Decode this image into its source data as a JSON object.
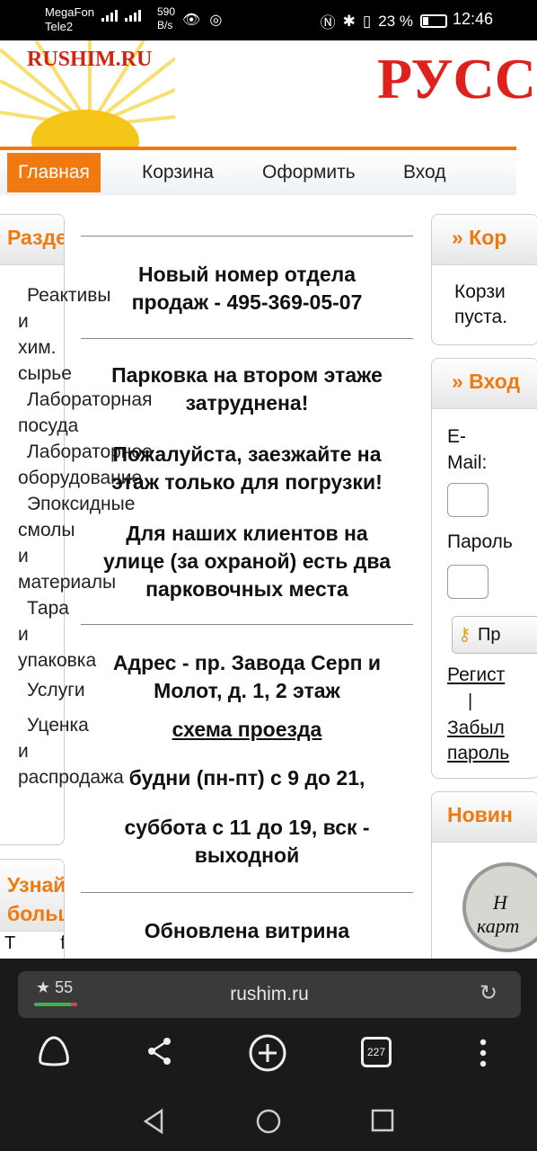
{
  "status": {
    "operator1": "MegaFon",
    "operator2": "Tele2",
    "speed": "590",
    "speed_unit": "B/s",
    "battery": "23 %",
    "time": "12:46"
  },
  "header": {
    "logo": "RUSHIM.RU",
    "banner": "РУССК"
  },
  "nav": {
    "home": "Главная",
    "cart": "Корзина",
    "checkout": "Оформить",
    "login": "Вход"
  },
  "sections": {
    "title": "Разделы",
    "items": [
      {
        "first": "Реактивы",
        "rest": [
          "и",
          "хим.",
          "сырье"
        ]
      },
      {
        "first": "Лабораторная",
        "rest": [
          "посуда"
        ]
      },
      {
        "first": "Лабораторное",
        "rest": [
          "оборудование"
        ]
      },
      {
        "first": "Эпоксидные",
        "rest": [
          "смолы",
          "и",
          "материалы"
        ]
      },
      {
        "first": "Тара",
        "rest": [
          "и",
          "упаковка"
        ]
      },
      {
        "first": "Услуги",
        "rest": []
      },
      {
        "first": "Уценка",
        "rest": [
          "и",
          "распродажа"
        ]
      }
    ]
  },
  "learn": {
    "title_line1": "Узнайте",
    "title_line2": "больше"
  },
  "center": {
    "phone_line1": "Новый номер отдела",
    "phone_line2": "продаж - 495-369-05-07",
    "parking1_line1": "Парковка на втором этаже",
    "parking1_line2": "затруднена!",
    "parking2_line1": "Пожалуйста, заезжайте на",
    "parking2_line2": "этаж только для погрузки!",
    "parking3_line1": "Для наших клиентов на",
    "parking3_line2": "улице (за охраной) есть два",
    "parking3_line3": "парковочных места",
    "address_line1": "Адрес - пр. Завода Серп и",
    "address_line2": "Молот, д. 1, 2 этаж",
    "map_link": "схема проезда",
    "weekdays": "будни (пн-пт) с 9 до 21,",
    "weekend_line1": "суббота с 11 до 19, вск -",
    "weekend_line2": "выходной",
    "showcase": "Обновлена витрина"
  },
  "cart_panel": {
    "title": "» Кор",
    "text_line1": "Корзи",
    "text_line2": "пуста."
  },
  "login_panel": {
    "title": "» Вход",
    "email_line1": "E-",
    "email_line2": "Mail:",
    "password": "Пароль",
    "submit": "Пр",
    "register": "Регист",
    "separator": "|",
    "forgot_line1": "Забыл",
    "forgot_line2": "пароль"
  },
  "news_panel": {
    "title": "Новин",
    "badge_line1": "Н",
    "badge_line2": "карт"
  },
  "learn_first": "T",
  "learn_second": "f",
  "browser": {
    "rating": "55",
    "url": "rushim.ru",
    "tabs_count": "227"
  }
}
